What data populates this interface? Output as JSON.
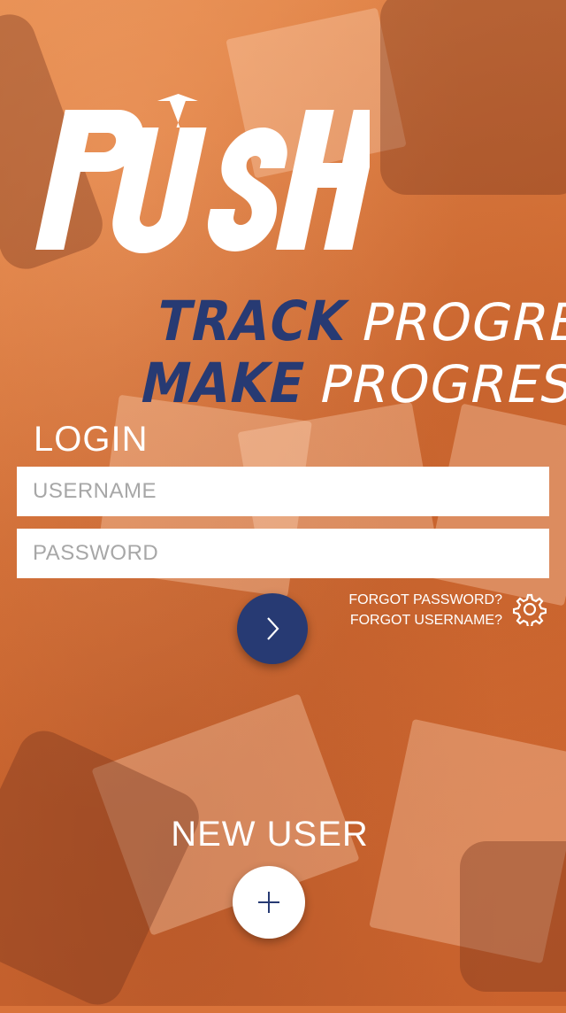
{
  "logo": {
    "text": "PUSH"
  },
  "tagline": {
    "line1_bold": "TRACK",
    "line1_light": "PROGRESS",
    "line2_bold": "MAKE",
    "line2_light": "PROGRESS"
  },
  "login": {
    "label": "LOGIN",
    "username_placeholder": "USERNAME",
    "password_placeholder": "PASSWORD",
    "forgot_password": "FORGOT PASSWORD?",
    "forgot_username": "FORGOT USERNAME?"
  },
  "new_user": {
    "label": "NEW USER"
  },
  "icons": {
    "submit": "chevron-right-icon",
    "settings": "gear-icon",
    "add": "plus-icon"
  },
  "colors": {
    "accent_navy": "#273a73",
    "background_orange": "#d9733a",
    "white": "#ffffff"
  }
}
